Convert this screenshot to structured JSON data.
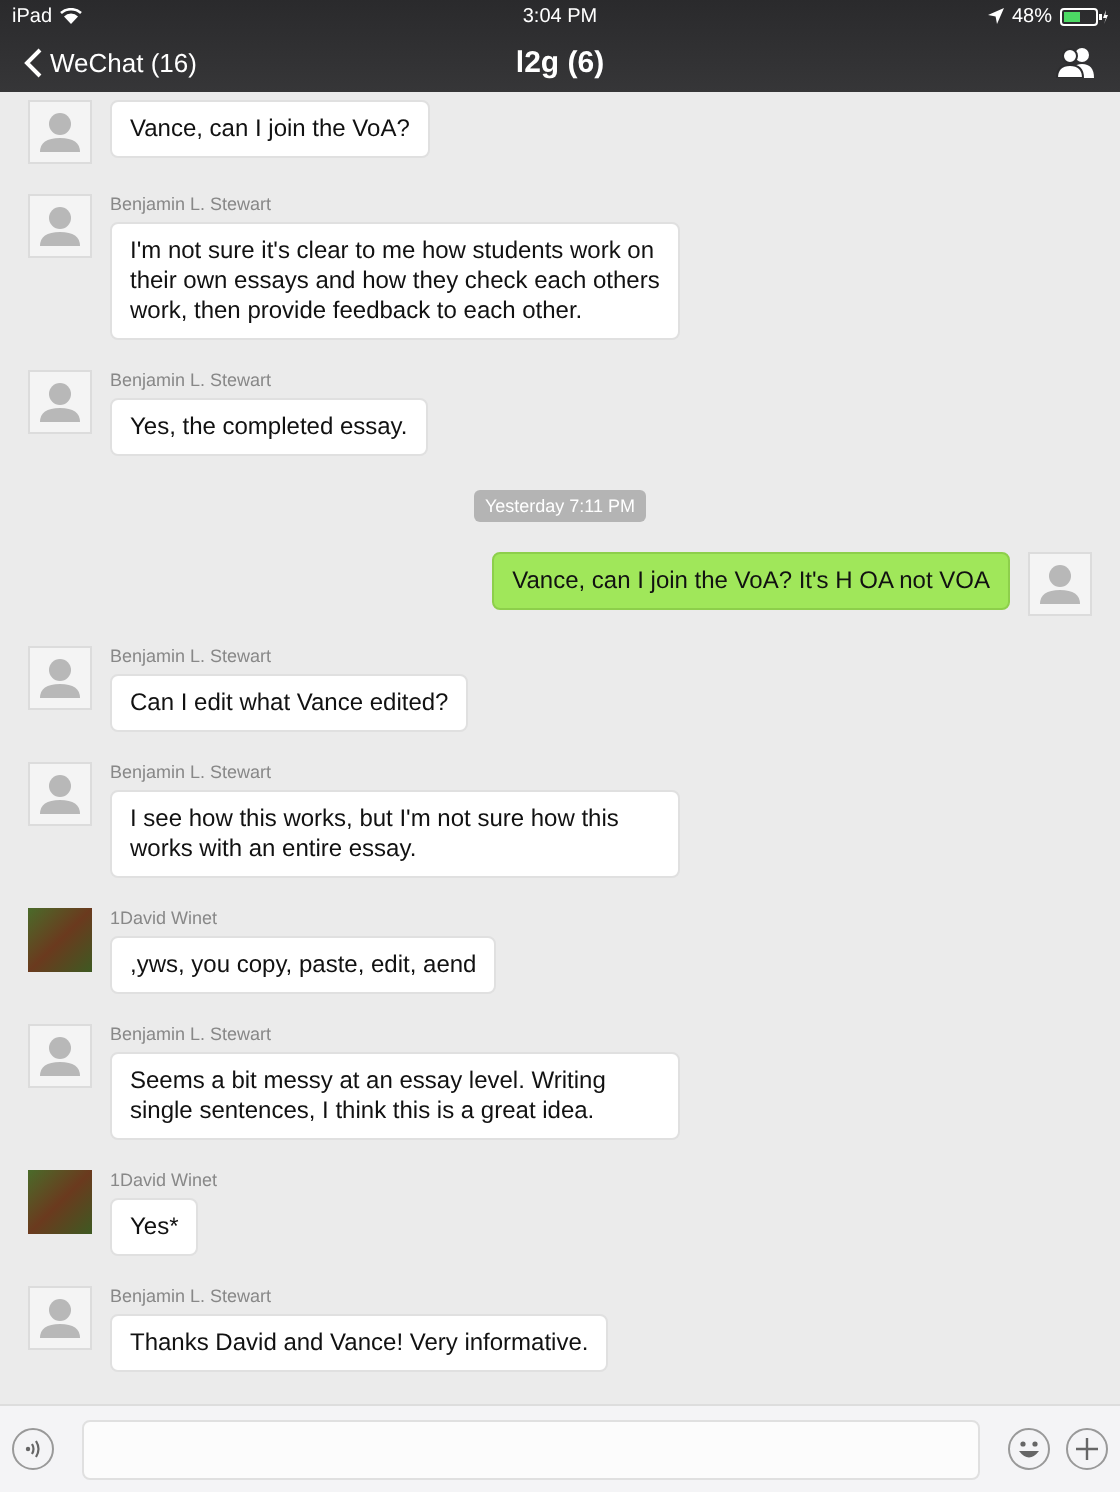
{
  "status_bar": {
    "device": "iPad",
    "time": "3:04 PM",
    "battery": "48%"
  },
  "nav": {
    "back": "WeChat (16)",
    "title": "l2g (6)"
  },
  "messages": [
    {
      "kind": "incoming",
      "photo_avatar": false,
      "text": "Vance, can I join the VoA?"
    },
    {
      "kind": "incoming",
      "photo_avatar": false,
      "sender": "Benjamin L. Stewart",
      "text": "I'm not sure it's clear to me how students work on their own essays and how they check each others work, then provide feedback to each other."
    },
    {
      "kind": "incoming",
      "photo_avatar": false,
      "sender": "Benjamin L. Stewart",
      "text": "Yes, the completed essay."
    },
    {
      "kind": "timestamp",
      "text": "Yesterday 7:11 PM"
    },
    {
      "kind": "outgoing",
      "photo_avatar": false,
      "text": "Vance, can I join the VoA? It's H OA not VOA"
    },
    {
      "kind": "incoming",
      "photo_avatar": false,
      "sender": "Benjamin L. Stewart",
      "text": "Can I edit what Vance edited?"
    },
    {
      "kind": "incoming",
      "photo_avatar": false,
      "sender": "Benjamin L. Stewart",
      "text": "I see how this works, but I'm not sure how this works with an entire essay."
    },
    {
      "kind": "incoming",
      "photo_avatar": true,
      "sender": "1David Winet",
      "text": ",yws, you copy, paste, edit, aend"
    },
    {
      "kind": "incoming",
      "photo_avatar": false,
      "sender": "Benjamin L. Stewart",
      "text": "Seems a bit messy at an essay level.  Writing single sentences, I think this is a great idea."
    },
    {
      "kind": "incoming",
      "photo_avatar": true,
      "sender": "1David Winet",
      "text": "Yes*"
    },
    {
      "kind": "incoming",
      "photo_avatar": false,
      "sender": "Benjamin L. Stewart",
      "text": "Thanks David and Vance!  Very informative."
    }
  ]
}
